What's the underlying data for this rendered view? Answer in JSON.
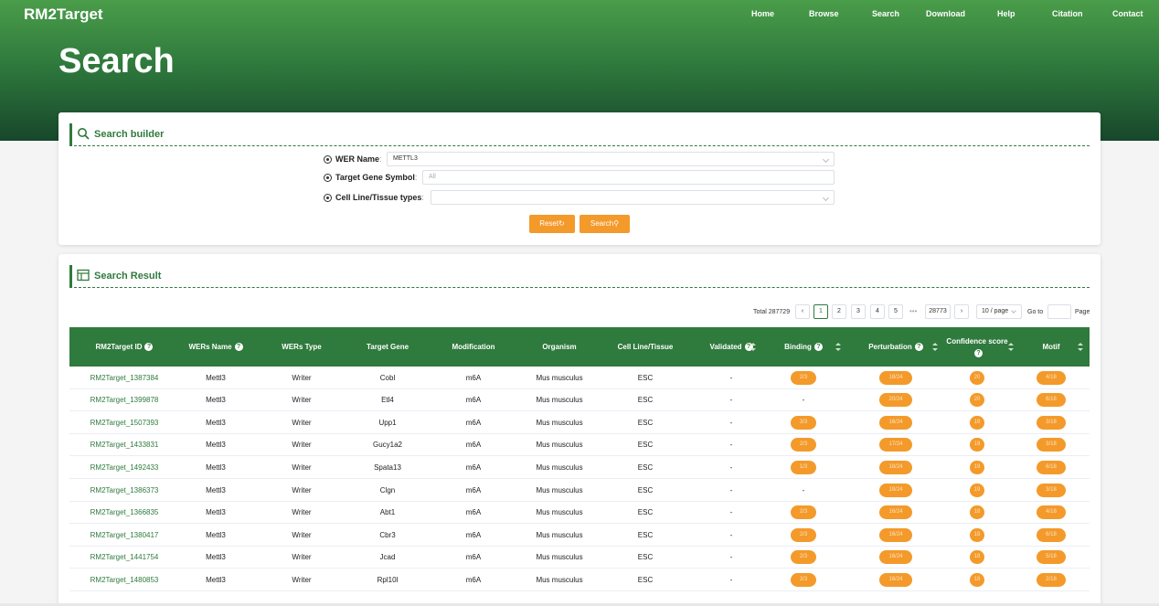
{
  "site": {
    "logo": "RM2Target"
  },
  "nav": [
    "Home",
    "Browse",
    "Search",
    "Download",
    "Help",
    "Citation",
    "Contact"
  ],
  "hero": {
    "title": "Search"
  },
  "search_builder": {
    "title": "Search builder",
    "fields": [
      {
        "label": "WER Name",
        "value": "METTL3",
        "placeholder": ""
      },
      {
        "label": "Target Gene Symbol",
        "value": "",
        "placeholder": "All"
      },
      {
        "label": "Cell Line/Tissue types",
        "value": "",
        "placeholder": ""
      }
    ],
    "reset_label": "Reset",
    "search_label": "Search"
  },
  "result": {
    "title": "Search Result",
    "pagination": {
      "total": "Total 287729",
      "pages": [
        "1",
        "2",
        "3",
        "4",
        "5"
      ],
      "last_page": "28773",
      "page_size": "10 / page",
      "goto_label": "Go to",
      "page_label": "Page"
    },
    "columns": [
      "RM2Target ID",
      "WERs Name",
      "WERs Type",
      "Target Gene",
      "Modification",
      "Organism",
      "Cell Line/Tissue",
      "Validated",
      "Binding",
      "Perturbation",
      "Confidence score",
      "Motif"
    ],
    "rows": [
      [
        "RM2Target_1387384",
        "Mettl3",
        "Writer",
        "Cobl",
        "m6A",
        "Mus musculus",
        "ESC",
        "-",
        "2/3",
        "18/24",
        "20",
        "4/18"
      ],
      [
        "RM2Target_1399878",
        "Mettl3",
        "Writer",
        "Etl4",
        "m6A",
        "Mus musculus",
        "ESC",
        "-",
        "-",
        "20/24",
        "20",
        "6/18"
      ],
      [
        "RM2Target_1507393",
        "Mettl3",
        "Writer",
        "Upp1",
        "m6A",
        "Mus musculus",
        "ESC",
        "-",
        "3/3",
        "16/24",
        "19",
        "3/18"
      ],
      [
        "RM2Target_1433831",
        "Mettl3",
        "Writer",
        "Gucy1a2",
        "m6A",
        "Mus musculus",
        "ESC",
        "-",
        "2/3",
        "17/24",
        "19",
        "3/18"
      ],
      [
        "RM2Target_1492433",
        "Mettl3",
        "Writer",
        "Spata13",
        "m6A",
        "Mus musculus",
        "ESC",
        "-",
        "1/3",
        "18/24",
        "19",
        "6/18"
      ],
      [
        "RM2Target_1386373",
        "Mettl3",
        "Writer",
        "Clgn",
        "m6A",
        "Mus musculus",
        "ESC",
        "-",
        "-",
        "19/24",
        "19",
        "3/18"
      ],
      [
        "RM2Target_1366835",
        "Mettl3",
        "Writer",
        "Abt1",
        "m6A",
        "Mus musculus",
        "ESC",
        "-",
        "2/3",
        "16/24",
        "18",
        "4/18"
      ],
      [
        "RM2Target_1380417",
        "Mettl3",
        "Writer",
        "Cbr3",
        "m6A",
        "Mus musculus",
        "ESC",
        "-",
        "2/3",
        "16/24",
        "18",
        "6/18"
      ],
      [
        "RM2Target_1441754",
        "Mettl3",
        "Writer",
        "Jcad",
        "m6A",
        "Mus musculus",
        "ESC",
        "-",
        "2/3",
        "16/24",
        "18",
        "5/18"
      ],
      [
        "RM2Target_1480853",
        "Mettl3",
        "Writer",
        "Rpl10l",
        "m6A",
        "Mus musculus",
        "ESC",
        "-",
        "2/3",
        "16/24",
        "18",
        "2/18"
      ]
    ]
  },
  "colors": {
    "green": "#2f7a3d",
    "orange": "#f39a2b"
  }
}
